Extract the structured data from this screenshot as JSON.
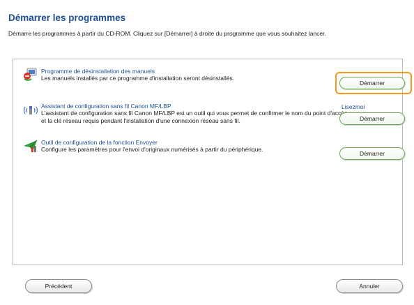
{
  "page": {
    "title": "Démarrer les programmes",
    "subtitle": "Démarre les programmes à partir du CD-ROM. Cliquez sur [Démarrer] à droite du programme que vous souhaitez lancer."
  },
  "programs": [
    {
      "icon": "uninstall-manuals-icon",
      "title": "Programme de désinstallation des manuels",
      "description": "Les manuels installés par ce programme d'installation seront désinstallés.",
      "button_label": "Démarrer"
    },
    {
      "icon": "wireless-setup-icon",
      "title": "Assistant de configuration sans fil Canon MF/LBP",
      "description": "L'assistant de configuration sans fil Canon MF/LBP est un outil qui vous permet de confirmer le nom du point d'accès et la clé réseau requis pendant l'installation d'une connexion réseau sans fil.",
      "link_label": "Lisezmoi",
      "button_label": "Démarrer"
    },
    {
      "icon": "send-function-config-icon",
      "title": "Outil de configuration de la fonction Envoyer",
      "description": "Configure les paramètres pour l'envoi d'originaux numérisés à partir du périphérique.",
      "button_label": "Démarrer"
    }
  ],
  "footer": {
    "back_label": "Précédent",
    "cancel_label": "Annuler"
  },
  "colors": {
    "title": "#1d4f91",
    "highlight": "#f39a1e",
    "button_border_green": "#6aa84f"
  }
}
